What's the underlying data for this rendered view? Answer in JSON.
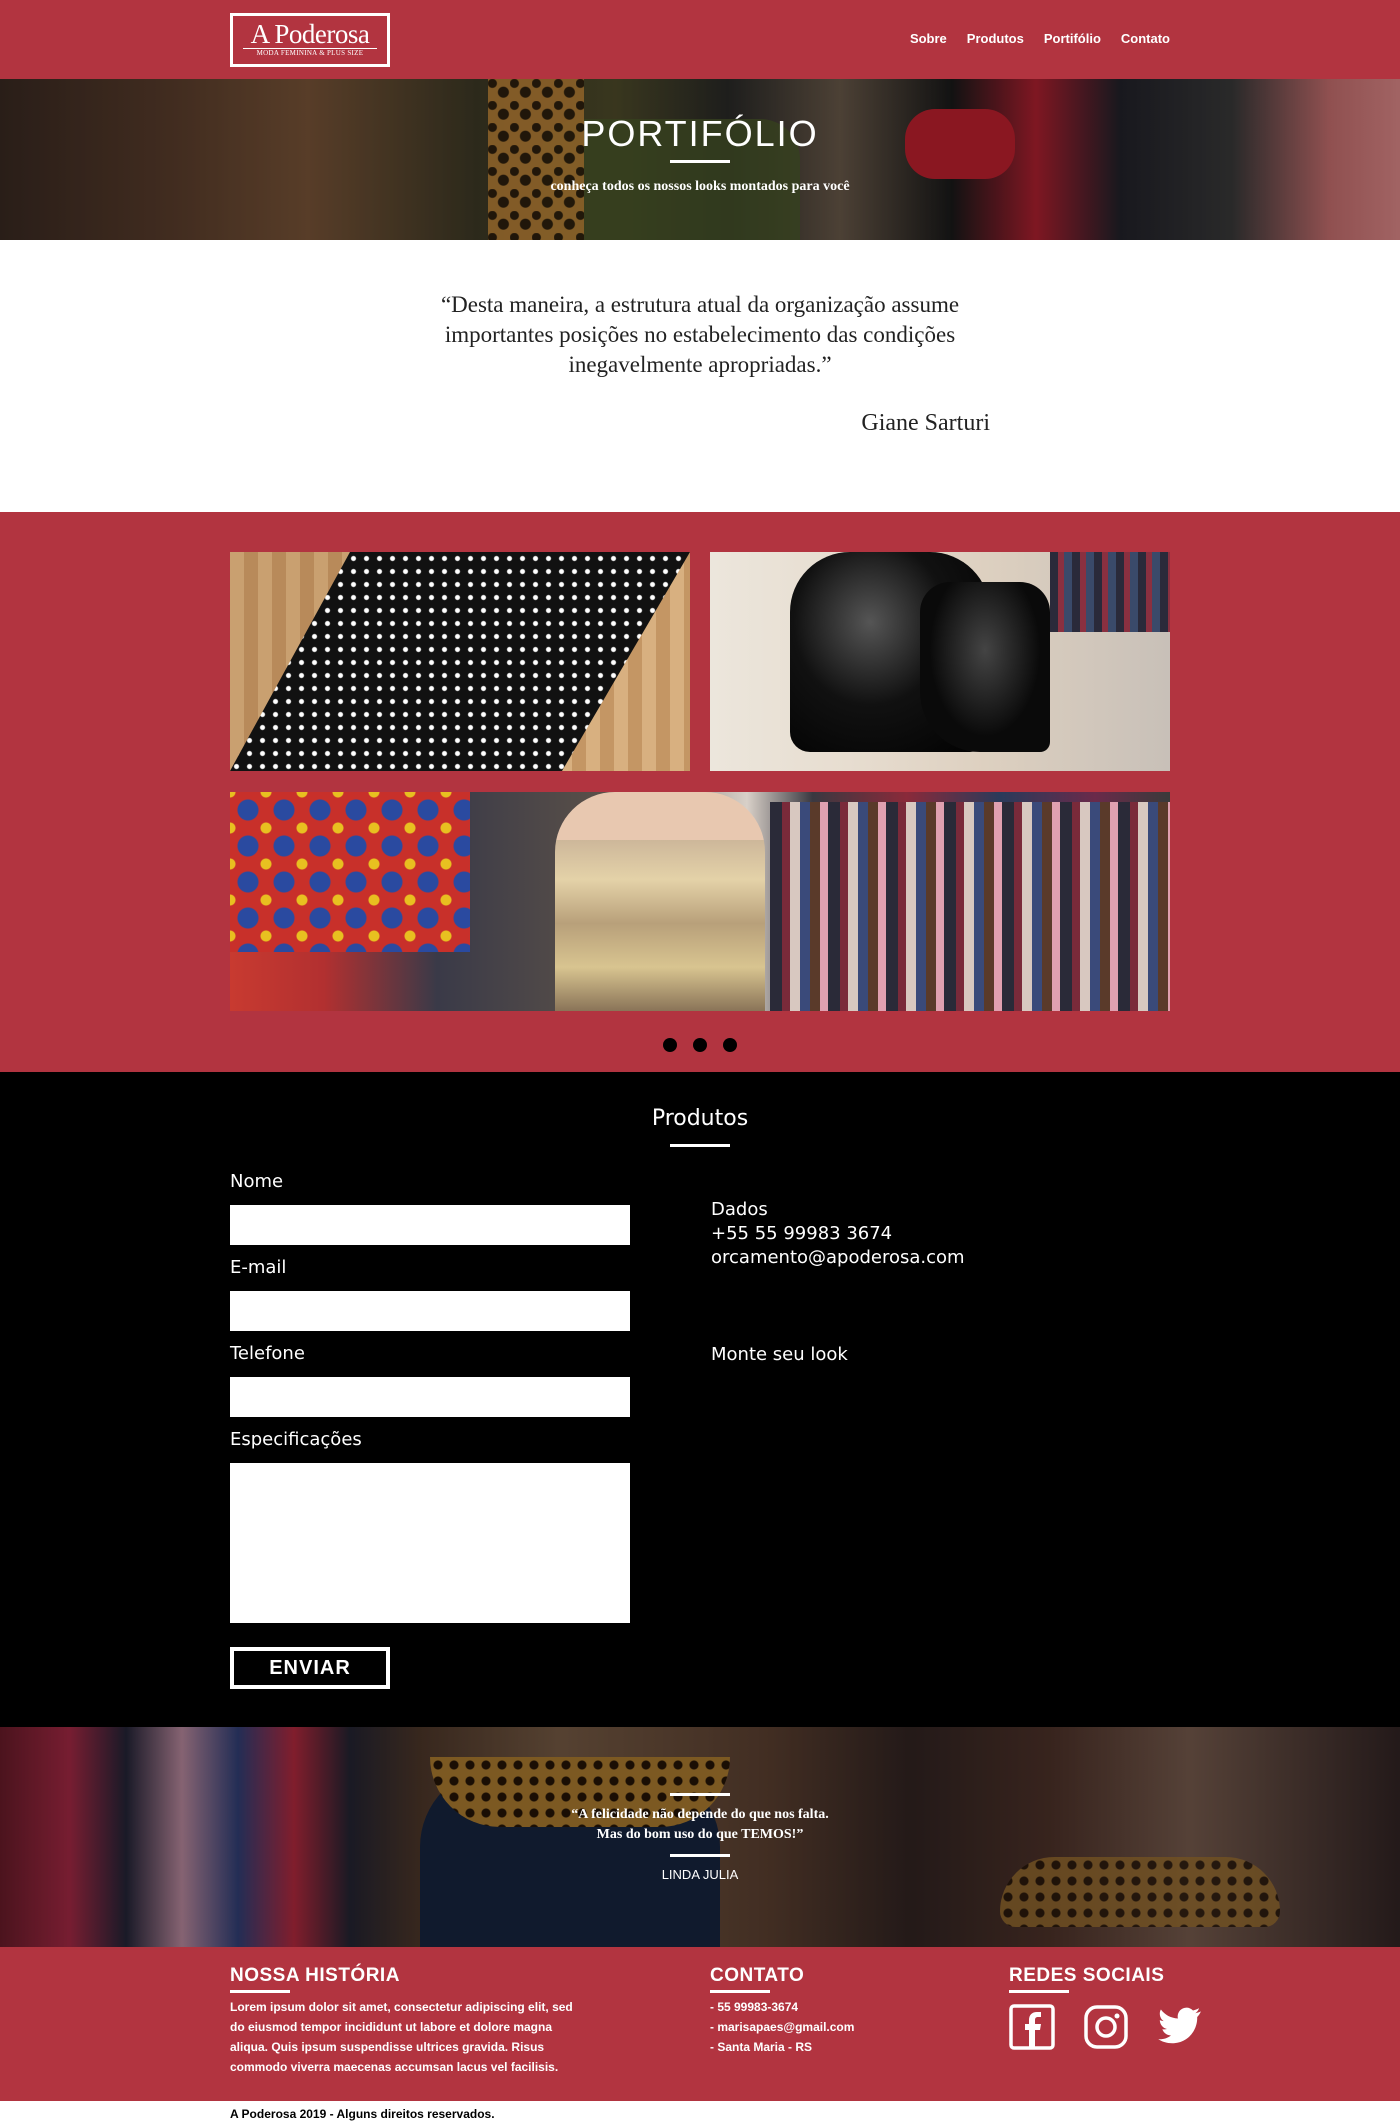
{
  "header": {
    "logo_title": "A Poderosa",
    "logo_subtitle": "MODA FEMININA & PLUS SIZE",
    "nav": [
      "Sobre",
      "Produtos",
      "Portifólio",
      "Contato"
    ]
  },
  "hero": {
    "title": "PORTIFÓLIO",
    "subtitle": "conheça todos os nossos looks montados para você"
  },
  "quote": {
    "text": "“Desta maneira, a estrutura atual da organização assume importantes posições no estabelecimento das condições inegavelmente apropriadas.”",
    "author": "Giane Sarturi"
  },
  "gallery": {
    "slide_count": 3
  },
  "form": {
    "title": "Produtos",
    "labels": {
      "name": "Nome",
      "email": "E-mail",
      "phone": "Telefone",
      "specs": "Especificações"
    },
    "send_label": "ENVIAR",
    "dados_title": "Dados",
    "dados_phone": "+55 55 99983 3674",
    "dados_email": "orcamento@apoderosa.com",
    "monte_label": "Monte seu look"
  },
  "band": {
    "quote_line1": "“A felicidade não depende do que nos falta.",
    "quote_line2": "Mas do bom uso do que TEMOS!”",
    "author": "LINDA JULIA"
  },
  "footer": {
    "history_title": "NOSSA HISTÓRIA",
    "history_lines": [
      "Lorem ipsum dolor sit amet, consectetur adipiscing elit, sed",
      "do eiusmod tempor incididunt ut labore et dolore magna",
      "aliqua. Quis ipsum suspendisse ultrices gravida. Risus",
      "commodo viverra maecenas accumsan lacus vel facilisis."
    ],
    "contact_title": "CONTATO",
    "contact_lines": [
      "- 55 99983-3674",
      "- marisapaes@gmail.com",
      "- Santa Maria - RS"
    ],
    "social_title": "REDES SOCIAIS",
    "social_icons": [
      "facebook-icon",
      "instagram-icon",
      "twitter-icon"
    ],
    "copyright": "A Poderosa 2019 - Alguns direitos reservados."
  },
  "colors": {
    "brand_red": "#b23440",
    "black": "#000000",
    "white": "#ffffff"
  }
}
